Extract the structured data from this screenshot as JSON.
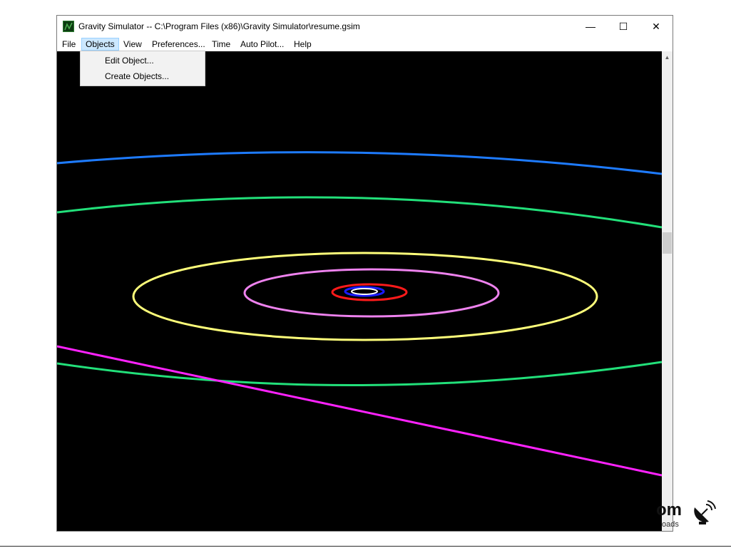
{
  "window": {
    "title": "Gravity Simulator -- C:\\Program Files (x86)\\Gravity Simulator\\resume.gsim",
    "controls": {
      "minimize": "—",
      "maximize": "☐",
      "close": "✕"
    }
  },
  "menubar": {
    "items": [
      "File",
      "Objects",
      "View",
      "Preferences...",
      "Time",
      "Auto Pilot...",
      "Help"
    ],
    "active": "Objects"
  },
  "objects_menu": {
    "items": [
      "Edit Object...",
      "Create Objects..."
    ]
  },
  "orbit_colors": {
    "outer_blue": "#1e7bff",
    "outer_green": "#22e07a",
    "yellow": "#ffff7a",
    "pink": "#ee82ee",
    "red": "#ff1a1a",
    "blue": "#1a1aff",
    "white": "#ffffff",
    "magenta": "#ff22ff"
  },
  "watermark": {
    "text": "om",
    "subtext": "oads",
    "icon": "satellite-dish-icon"
  },
  "icons": {
    "app": "gravity-simulator-app-icon",
    "scroll_up": "scroll-up-arrow-icon"
  }
}
